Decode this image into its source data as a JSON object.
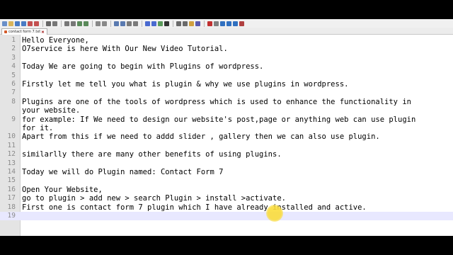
{
  "tab": {
    "title": "contact form 7.txt"
  },
  "toolbar_icons": [
    "new-file-icon",
    "open-icon",
    "save-icon",
    "save-all-icon",
    "close-icon",
    "close-all-icon",
    "print-icon",
    "cut-icon",
    "copy-icon",
    "paste-icon",
    "undo-icon",
    "redo-icon",
    "find-icon",
    "replace-icon",
    "zoom-in-icon",
    "zoom-out-icon",
    "sync-v-icon",
    "sync-h-icon",
    "word-wrap-icon",
    "show-all-icon",
    "indent-guide-icon",
    "lang-icon",
    "map-icon",
    "func-icon",
    "folder-icon",
    "monitor-icon",
    "record-icon",
    "stop-icon",
    "play-icon",
    "play-multi-icon",
    "save-macro-icon",
    "spellcheck-icon"
  ],
  "lines": [
    {
      "n": "1",
      "t": "Hello Everyone,"
    },
    {
      "n": "2",
      "t": "O7service is here With Our New Video Tutorial."
    },
    {
      "n": "3",
      "t": ""
    },
    {
      "n": "4",
      "t": "Today We are going to begin with Plugins of wordpress."
    },
    {
      "n": "5",
      "t": ""
    },
    {
      "n": "6",
      "t": "Firstly let me tell you what is plugin & why we use plugins in wordpress."
    },
    {
      "n": "7",
      "t": ""
    },
    {
      "n": "8",
      "t": "Plugins are one of the tools of wordpress which is used to enhance the functionality in"
    },
    {
      "n": "",
      "t": "your website."
    },
    {
      "n": "9",
      "t": "for example: If We need to design our website's post,page or anything web can use plugin"
    },
    {
      "n": "",
      "t": "for it."
    },
    {
      "n": "10",
      "t": "Apart from this if we need to addd slider , gallery then we can also use plugin."
    },
    {
      "n": "11",
      "t": ""
    },
    {
      "n": "12",
      "t": "similarlly there are many other benefits of using plugins."
    },
    {
      "n": "13",
      "t": ""
    },
    {
      "n": "14",
      "t": "Today we will do Plugin named: Contact Form 7"
    },
    {
      "n": "15",
      "t": ""
    },
    {
      "n": "16",
      "t": "Open Your Website,"
    },
    {
      "n": "17",
      "t": "go to plugin > add new > search Plugin > install >activate."
    },
    {
      "n": "18",
      "t": "First one is contact form 7 plugin which I have already installed and active."
    },
    {
      "n": "19",
      "t": ""
    }
  ]
}
